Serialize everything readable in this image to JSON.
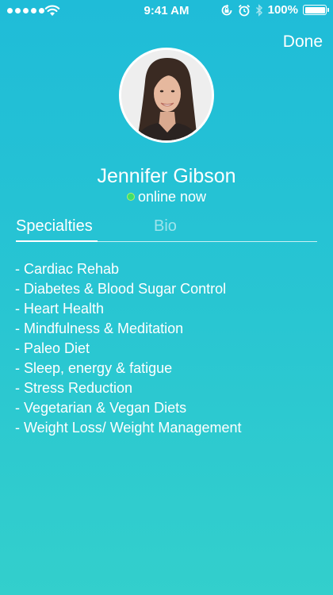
{
  "status_bar": {
    "time": "9:41 AM",
    "battery": "100%",
    "icons": [
      "signal-dots-icon",
      "wifi-icon",
      "orientation-lock-icon",
      "alarm-icon",
      "bluetooth-icon",
      "battery-icon"
    ]
  },
  "nav": {
    "done_label": "Done"
  },
  "profile": {
    "name": "Jennifer Gibson",
    "status": "online now",
    "status_color": "#3ee06a"
  },
  "tabs": [
    {
      "label": "Specialties",
      "active": true
    },
    {
      "label": "Bio",
      "active": false
    }
  ],
  "specialties": [
    "- Cardiac Rehab",
    "- Diabetes & Blood Sugar Control",
    "- Heart Health",
    "- Mindfulness & Meditation",
    "- Paleo Diet",
    "- Sleep, energy & fatigue",
    "- Stress Reduction",
    "- Vegetarian & Vegan Diets",
    "- Weight Loss/ Weight Management"
  ],
  "colors": {
    "background_top": "#1fbcd8",
    "background_bottom": "#33cfcc",
    "text": "#ffffff"
  }
}
